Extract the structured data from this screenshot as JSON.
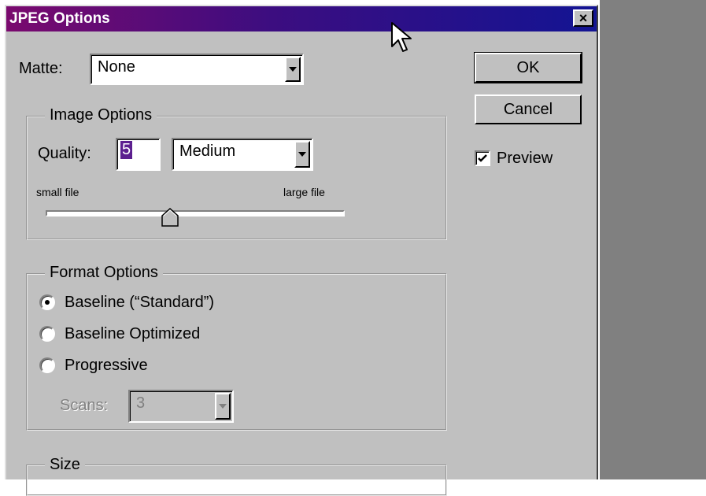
{
  "window": {
    "title": "JPEG Options",
    "close_label": "×"
  },
  "matte": {
    "label": "Matte:",
    "value": "None"
  },
  "image_options": {
    "title": "Image Options",
    "quality_label": "Quality:",
    "quality_value": "5",
    "quality_preset": "Medium",
    "slider_min_label": "small file",
    "slider_max_label": "large file"
  },
  "format_options": {
    "title": "Format Options",
    "options": [
      "Baseline (“Standard”)",
      "Baseline Optimized",
      "Progressive"
    ],
    "selected": "Baseline (“Standard”)",
    "scans_label": "Scans:",
    "scans_value": "3"
  },
  "size": {
    "title": "Size"
  },
  "buttons": {
    "ok": "OK",
    "cancel": "Cancel"
  },
  "preview": {
    "label": "Preview",
    "checked": true
  },
  "icons": {
    "cursor": "mouse-pointer-icon",
    "check": "check-icon",
    "dropdown": "chevron-down-icon"
  },
  "colors": {
    "title_left": "#7a0a6e",
    "title_right": "#131493",
    "face": "#c0c0c0",
    "selection": "#5c1f8f"
  }
}
